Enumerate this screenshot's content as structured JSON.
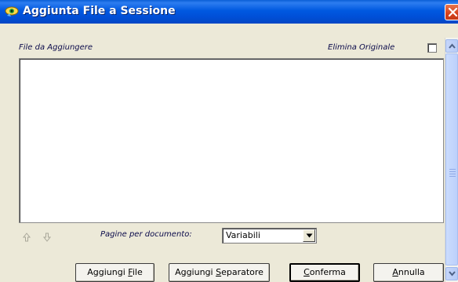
{
  "window": {
    "title": "Aggiunta File a Sessione"
  },
  "header": {
    "files_label": "File da Aggiungere",
    "delete_original_label": "Elimina Originale",
    "delete_original_checked": false
  },
  "file_list": {
    "items": []
  },
  "pages": {
    "label": "Pagine per documento:",
    "selected": "Variabili"
  },
  "buttons": {
    "add_file": {
      "pre": "Aggiungi ",
      "acc": "F",
      "post": "ile"
    },
    "add_separator": {
      "pre": "Aggiungi ",
      "acc": "S",
      "post": "eparatore"
    },
    "confirm": {
      "pre": "",
      "acc": "C",
      "post": "onferma"
    },
    "cancel": {
      "pre": "",
      "acc": "A",
      "post": "nnulla"
    }
  },
  "icons": {
    "title": "app-eye-icon",
    "close": "close-icon",
    "move_up": "arrow-up-icon",
    "move_down": "arrow-down-icon"
  },
  "colors": {
    "titlebar": "#0058e0",
    "close": "#d6401a",
    "label_text": "#0a0a4a",
    "face": "#ece9d8"
  }
}
